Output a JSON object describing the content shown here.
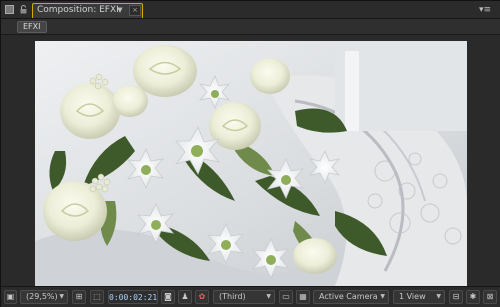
{
  "tab": {
    "title": "Composition: EFXI"
  },
  "breadcrumb": {
    "label": "EFXI"
  },
  "footer": {
    "magnification": "(29,5%)",
    "timecode": "0:00:02:21",
    "resolution": "(Third)",
    "camera": "Active Camera",
    "views": "1 View"
  },
  "icons": {
    "panel_lock": "lock-icon",
    "close": "close-icon",
    "panel_menu": "panel-menu-icon",
    "snapshot": "camera-icon",
    "color_channels": "rgb-icon",
    "grid": "grid-icon",
    "safe_zones": "safe-zones-icon",
    "transparency": "checkerboard-icon"
  },
  "colors": {
    "active_tab_outline": "#d9a800",
    "timecode_text": "#a8d3ff"
  }
}
